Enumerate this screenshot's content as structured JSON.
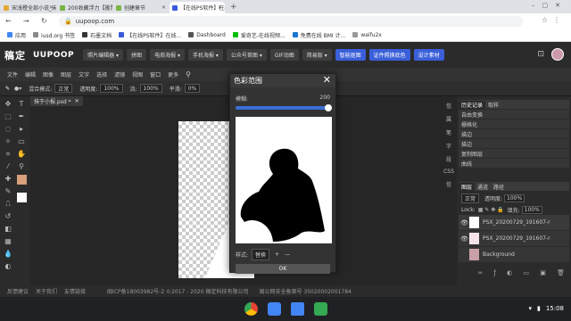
{
  "browser": {
    "tabs": [
      {
        "label": "宋浅橙全部小说_宋浅橙作品列表",
        "favicon": "#e8a838",
        "active": false
      },
      {
        "label": "200收藏浮力【投票】-怡免",
        "favicon": "#7cb342",
        "active": false
      },
      {
        "label": "创建章节",
        "favicon": "#7cb342",
        "active": false
      },
      {
        "label": "【在线PS软件】在线PS图片",
        "favicon": "#3b5bdb",
        "active": true
      }
    ],
    "new_tab": "+",
    "url": "uupoop.com",
    "bookmarks": [
      {
        "label": "应用",
        "favicon": "#4285f4"
      },
      {
        "label": "iusd.org 书签",
        "favicon": "#888888"
      },
      {
        "label": "石墨文档",
        "favicon": "#333333"
      },
      {
        "label": "【在线PS软件】在线...",
        "favicon": "#3b5bdb"
      },
      {
        "label": "Dashboard",
        "favicon": "#555555"
      },
      {
        "label": "爱奇艺-在线视频...",
        "favicon": "#00be06"
      },
      {
        "label": "免费在线 BMI 计...",
        "favicon": "#1976d2"
      },
      {
        "label": "waifu2x",
        "favicon": "#999999"
      }
    ]
  },
  "app": {
    "logo": "稿定",
    "brand": "UUPOOP",
    "nav": [
      {
        "label": "照片编辑器 ▾",
        "blue": false
      },
      {
        "label": "拼图",
        "blue": false
      },
      {
        "label": "电商海报 ▾",
        "blue": false
      },
      {
        "label": "手机海报 ▾",
        "blue": false
      },
      {
        "label": "公众号首图 ▾",
        "blue": false
      },
      {
        "label": "GIF动图",
        "blue": false
      },
      {
        "label": "简易版 ▾",
        "blue": false
      },
      {
        "label": "智能抠图",
        "blue": true
      },
      {
        "label": "证件照换底色",
        "blue": true
      },
      {
        "label": "设计素材",
        "blue": true
      }
    ]
  },
  "menubar": [
    "文件",
    "编辑",
    "图像",
    "图层",
    "文字",
    "选择",
    "滤镜",
    "视图",
    "窗口",
    "更多"
  ],
  "options": {
    "blend_label": "混合模式:",
    "blend_value": "正常",
    "opacity_label": "透明度:",
    "opacity_value": "100%",
    "flow_label": "流:",
    "flow_value": "100%",
    "smooth_label": "平滑:",
    "smooth_value": "0%"
  },
  "document": {
    "tab": "抹于小报.psd *"
  },
  "dialog": {
    "title": "色彩范围",
    "fuzziness_label": "模糊:",
    "fuzziness_value": "200",
    "fuzziness_fraction": 1.0,
    "style_label": "样式:",
    "style_value": "替换",
    "add_label": "+",
    "subtract_label": "—",
    "ok_label": "OK"
  },
  "side_tabs": [
    "信",
    "属",
    "笔",
    "字",
    "段",
    "CSS",
    "信"
  ],
  "history": {
    "tabs": [
      "历史记录",
      "取样"
    ],
    "items": [
      "自由变换",
      "栅格化",
      "描边",
      "描边",
      "复制图层",
      "曲线"
    ]
  },
  "layers": {
    "tabs": [
      "图层",
      "通道",
      "路径"
    ],
    "blend": "正常",
    "opacity_label": "透明度:",
    "opacity_value": "100%",
    "lock_label": "Lock:",
    "fill_label": "填充:",
    "fill_value": "100%",
    "items": [
      {
        "name": "PSX_20200729_191607-r"
      },
      {
        "name": "PSX_20200729_191607-r"
      },
      {
        "name": "Background"
      }
    ]
  },
  "footer": {
    "links": [
      "反馈建议",
      "关于我们",
      "友情链接"
    ],
    "icp": "闽ICP备18003982号-2 ©2017 - 2020 稿定科技有限公司",
    "security": "闽公网安全备案号 35020002001784"
  },
  "taskbar": {
    "time": "15:08"
  }
}
